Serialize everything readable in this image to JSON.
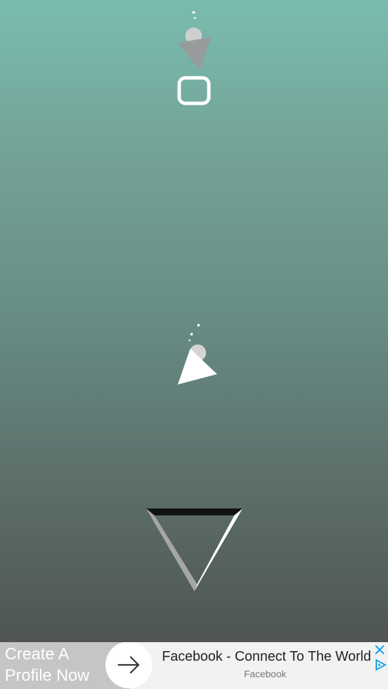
{
  "colors": {
    "background_top": "#7bbcb0",
    "background_bottom": "#4f5553",
    "shape_white": "#ffffff",
    "shape_gray": "#9a9a9a",
    "ad_blue": "#1aa3e8"
  },
  "game": {
    "top_player_icon": "triangle-pointer-with-ball",
    "top_gate_icon": "rounded-square-outline",
    "middle_player_icon": "triangle-pointer-with-ball",
    "bottom_gate_icon": "triangle-outline"
  },
  "ad": {
    "left_text": "Create A Profile Now",
    "title": "Facebook - Connect To The World",
    "subtitle": "Facebook",
    "arrow_icon": "arrow-right-icon",
    "close_icon": "close-icon",
    "adchoices_icon": "adchoices-icon"
  }
}
